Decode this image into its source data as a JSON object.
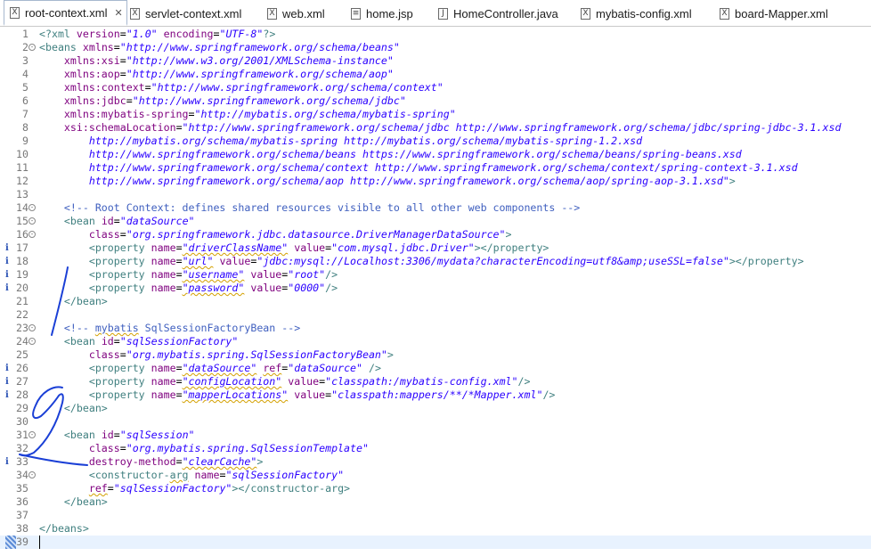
{
  "tabs": [
    {
      "label": "root-context.xml",
      "icon": "xml-file-icon",
      "active": true,
      "closable": true
    },
    {
      "label": "servlet-context.xml",
      "icon": "xml-file-icon"
    },
    {
      "label": "web.xml",
      "icon": "xml-file-icon"
    },
    {
      "label": "home.jsp",
      "icon": "jsp-file-icon"
    },
    {
      "label": "HomeController.java",
      "icon": "java-file-icon"
    },
    {
      "label": "mybatis-config.xml",
      "icon": "xml-file-icon"
    },
    {
      "label": "board-Mapper.xml",
      "icon": "xml-file-icon"
    }
  ],
  "colors": {
    "tag": "#3f7f7f",
    "attr": "#7f007f",
    "value": "#2a00ff",
    "comment": "#3f5fbf",
    "ink": "#1a3fd6",
    "info": "#2850b4"
  },
  "lines": [
    {
      "n": "1",
      "segs": [
        [
          "pi",
          "<?xml "
        ],
        [
          "attr",
          "version"
        ],
        [
          "txt",
          "="
        ],
        [
          "val",
          "\"1.0\""
        ],
        [
          "txt",
          " "
        ],
        [
          "attr",
          "encoding"
        ],
        [
          "txt",
          "="
        ],
        [
          "val",
          "\"UTF-8\""
        ],
        [
          "pi",
          "?>"
        ]
      ]
    },
    {
      "n": "2",
      "fold": "-",
      "segs": [
        [
          "tag",
          "<beans "
        ],
        [
          "attr",
          "xmlns"
        ],
        [
          "txt",
          "="
        ],
        [
          "val",
          "\"http://www.springframework.org/schema/beans\""
        ]
      ]
    },
    {
      "n": "3",
      "segs": [
        [
          "txt",
          "    "
        ],
        [
          "attr",
          "xmlns:xsi"
        ],
        [
          "txt",
          "="
        ],
        [
          "val",
          "\"http://www.w3.org/2001/XMLSchema-instance\""
        ]
      ]
    },
    {
      "n": "4",
      "segs": [
        [
          "txt",
          "    "
        ],
        [
          "attr",
          "xmlns:aop"
        ],
        [
          "txt",
          "="
        ],
        [
          "val",
          "\"http://www.springframework.org/schema/aop\""
        ]
      ]
    },
    {
      "n": "5",
      "segs": [
        [
          "txt",
          "    "
        ],
        [
          "attr",
          "xmlns:context"
        ],
        [
          "txt",
          "="
        ],
        [
          "val",
          "\"http://www.springframework.org/schema/context\""
        ]
      ]
    },
    {
      "n": "6",
      "segs": [
        [
          "txt",
          "    "
        ],
        [
          "attr",
          "xmlns:jdbc"
        ],
        [
          "txt",
          "="
        ],
        [
          "val",
          "\"http://www.springframework.org/schema/jdbc\""
        ]
      ]
    },
    {
      "n": "7",
      "segs": [
        [
          "txt",
          "    "
        ],
        [
          "attr",
          "xmlns:mybatis-spring"
        ],
        [
          "txt",
          "="
        ],
        [
          "val",
          "\"http://mybatis.org/schema/mybatis-spring\""
        ]
      ]
    },
    {
      "n": "8",
      "segs": [
        [
          "txt",
          "    "
        ],
        [
          "attr",
          "xsi:schemaLocation"
        ],
        [
          "txt",
          "="
        ],
        [
          "val",
          "\"http://www.springframework.org/schema/jdbc http://www.springframework.org/schema/jdbc/spring-jdbc-3.1.xsd"
        ]
      ]
    },
    {
      "n": "9",
      "segs": [
        [
          "txt",
          "        "
        ],
        [
          "val",
          "http://mybatis.org/schema/mybatis-spring http://mybatis.org/schema/mybatis-spring-1.2.xsd"
        ]
      ]
    },
    {
      "n": "10",
      "segs": [
        [
          "txt",
          "        "
        ],
        [
          "val",
          "http://www.springframework.org/schema/beans https://www.springframework.org/schema/beans/spring-beans.xsd"
        ]
      ]
    },
    {
      "n": "11",
      "segs": [
        [
          "txt",
          "        "
        ],
        [
          "val",
          "http://www.springframework.org/schema/context http://www.springframework.org/schema/context/spring-context-3.1.xsd"
        ]
      ]
    },
    {
      "n": "12",
      "segs": [
        [
          "txt",
          "        "
        ],
        [
          "val",
          "http://www.springframework.org/schema/aop http://www.springframework.org/schema/aop/spring-aop-3.1.xsd\""
        ],
        [
          "tag",
          ">"
        ]
      ]
    },
    {
      "n": "13",
      "segs": []
    },
    {
      "n": "14",
      "fold": "-",
      "segs": [
        [
          "txt",
          "    "
        ],
        [
          "com",
          "<!-- Root Context: defines shared resources visible to all other web components -->"
        ]
      ]
    },
    {
      "n": "15",
      "fold": "-",
      "segs": [
        [
          "txt",
          "    "
        ],
        [
          "tag",
          "<bean "
        ],
        [
          "attr",
          "id"
        ],
        [
          "txt",
          "="
        ],
        [
          "val",
          "\"dataSource\""
        ]
      ]
    },
    {
      "n": "16",
      "fold": "-",
      "segs": [
        [
          "txt",
          "        "
        ],
        [
          "attr",
          "class"
        ],
        [
          "txt",
          "="
        ],
        [
          "val",
          "\"org.springframework.jdbc.datasource.DriverManagerDataSource\""
        ],
        [
          "tag",
          ">"
        ]
      ]
    },
    {
      "n": "17",
      "info": "i",
      "segs": [
        [
          "txt",
          "        "
        ],
        [
          "tag",
          "<property "
        ],
        [
          "attr",
          "name"
        ],
        [
          "txt",
          "="
        ],
        [
          "val",
          "\"driverClassName\"",
          "sq"
        ],
        [
          "txt",
          " "
        ],
        [
          "attr",
          "value"
        ],
        [
          "txt",
          "="
        ],
        [
          "val",
          "\"com.mysql.jdbc.Driver\""
        ],
        [
          "tag",
          "></property>"
        ]
      ]
    },
    {
      "n": "18",
      "info": "i",
      "segs": [
        [
          "txt",
          "        "
        ],
        [
          "tag",
          "<property "
        ],
        [
          "attr",
          "name"
        ],
        [
          "txt",
          "="
        ],
        [
          "val",
          "\"url\"",
          "sq"
        ],
        [
          "txt",
          " "
        ],
        [
          "attr",
          "value"
        ],
        [
          "txt",
          "="
        ],
        [
          "val",
          "\"jdbc:mysql://Localhost:3306/mydata?characterEncoding=utf8&amp;useSSL=false\""
        ],
        [
          "tag",
          "></property>"
        ]
      ]
    },
    {
      "n": "19",
      "info": "i",
      "segs": [
        [
          "txt",
          "        "
        ],
        [
          "tag",
          "<property "
        ],
        [
          "attr",
          "name"
        ],
        [
          "txt",
          "="
        ],
        [
          "val",
          "\"username\"",
          "sq"
        ],
        [
          "txt",
          " "
        ],
        [
          "attr",
          "value"
        ],
        [
          "txt",
          "="
        ],
        [
          "val",
          "\"root\""
        ],
        [
          "tag",
          "/>"
        ]
      ]
    },
    {
      "n": "20",
      "info": "i",
      "segs": [
        [
          "txt",
          "        "
        ],
        [
          "tag",
          "<property "
        ],
        [
          "attr",
          "name"
        ],
        [
          "txt",
          "="
        ],
        [
          "val",
          "\"password\"",
          "sq"
        ],
        [
          "txt",
          " "
        ],
        [
          "attr",
          "value"
        ],
        [
          "txt",
          "="
        ],
        [
          "val",
          "\"0000\""
        ],
        [
          "tag",
          "/>"
        ]
      ]
    },
    {
      "n": "21",
      "segs": [
        [
          "txt",
          "    "
        ],
        [
          "tag",
          "</bean>"
        ]
      ]
    },
    {
      "n": "22",
      "segs": []
    },
    {
      "n": "23",
      "fold": "-",
      "segs": [
        [
          "txt",
          "    "
        ],
        [
          "com",
          "<!-- "
        ],
        [
          "com",
          "mybatis",
          "sq"
        ],
        [
          "com",
          " SqlSessionFactoryBean -->"
        ]
      ]
    },
    {
      "n": "24",
      "fold": "-",
      "segs": [
        [
          "txt",
          "    "
        ],
        [
          "tag",
          "<bean "
        ],
        [
          "attr",
          "id"
        ],
        [
          "txt",
          "="
        ],
        [
          "val",
          "\"sqlSessionFactory\""
        ]
      ]
    },
    {
      "n": "25",
      "segs": [
        [
          "txt",
          "        "
        ],
        [
          "attr",
          "class"
        ],
        [
          "txt",
          "="
        ],
        [
          "val",
          "\"org.mybatis.spring.SqlSessionFactoryBean\""
        ],
        [
          "tag",
          ">"
        ]
      ]
    },
    {
      "n": "26",
      "info": "i",
      "segs": [
        [
          "txt",
          "        "
        ],
        [
          "tag",
          "<property "
        ],
        [
          "attr",
          "name"
        ],
        [
          "txt",
          "="
        ],
        [
          "val",
          "\"dataSource\"",
          "sq"
        ],
        [
          "txt",
          " "
        ],
        [
          "attr",
          "ref",
          "sq"
        ],
        [
          "txt",
          "="
        ],
        [
          "val",
          "\"dataSource\""
        ],
        [
          "txt",
          " "
        ],
        [
          "tag",
          "/>"
        ]
      ]
    },
    {
      "n": "27",
      "info": "i",
      "segs": [
        [
          "txt",
          "        "
        ],
        [
          "tag",
          "<property "
        ],
        [
          "attr",
          "name"
        ],
        [
          "txt",
          "="
        ],
        [
          "val",
          "\"configLocation\"",
          "sq"
        ],
        [
          "txt",
          " "
        ],
        [
          "attr",
          "value"
        ],
        [
          "txt",
          "="
        ],
        [
          "val",
          "\"classpath:/mybatis-config.xml\""
        ],
        [
          "tag",
          "/>"
        ]
      ]
    },
    {
      "n": "28",
      "info": "i",
      "segs": [
        [
          "txt",
          "        "
        ],
        [
          "tag",
          "<property "
        ],
        [
          "attr",
          "name"
        ],
        [
          "txt",
          "="
        ],
        [
          "val",
          "\"mapperLocations\"",
          "sq"
        ],
        [
          "txt",
          " "
        ],
        [
          "attr",
          "value"
        ],
        [
          "txt",
          "="
        ],
        [
          "val",
          "\"classpath:mappers/**/*Mapper.xml\""
        ],
        [
          "tag",
          "/>"
        ]
      ]
    },
    {
      "n": "29",
      "segs": [
        [
          "txt",
          "    "
        ],
        [
          "tag",
          "</bean>"
        ]
      ]
    },
    {
      "n": "30",
      "segs": []
    },
    {
      "n": "31",
      "fold": "-",
      "segs": [
        [
          "txt",
          "    "
        ],
        [
          "tag",
          "<bean "
        ],
        [
          "attr",
          "id"
        ],
        [
          "txt",
          "="
        ],
        [
          "val",
          "\"sqlSession\""
        ]
      ]
    },
    {
      "n": "32",
      "segs": [
        [
          "txt",
          "        "
        ],
        [
          "attr",
          "class"
        ],
        [
          "txt",
          "="
        ],
        [
          "val",
          "\"org.mybatis.spring.SqlSessionTemplate\""
        ]
      ]
    },
    {
      "n": "33",
      "info": "i",
      "segs": [
        [
          "txt",
          "        "
        ],
        [
          "attr",
          "destroy-method"
        ],
        [
          "txt",
          "="
        ],
        [
          "val",
          "\"clearCache\"",
          "sq"
        ],
        [
          "tag",
          ">"
        ]
      ]
    },
    {
      "n": "34",
      "fold": "-",
      "segs": [
        [
          "txt",
          "        "
        ],
        [
          "tag",
          "<constructor-"
        ],
        [
          "tag",
          "arg",
          "sq"
        ],
        [
          "txt",
          " "
        ],
        [
          "attr",
          "name"
        ],
        [
          "txt",
          "="
        ],
        [
          "val",
          "\"sqlSessionFactory\""
        ]
      ]
    },
    {
      "n": "35",
      "segs": [
        [
          "txt",
          "        "
        ],
        [
          "attr",
          "ref",
          "sq"
        ],
        [
          "txt",
          "="
        ],
        [
          "val",
          "\"sqlSessionFactory\""
        ],
        [
          "tag",
          "></constructor-arg>"
        ]
      ]
    },
    {
      "n": "36",
      "segs": [
        [
          "txt",
          "    "
        ],
        [
          "tag",
          "</bean>"
        ]
      ]
    },
    {
      "n": "37",
      "segs": []
    },
    {
      "n": "38",
      "segs": [
        [
          "tag",
          "</beans>"
        ]
      ]
    },
    {
      "n": "39",
      "current": true,
      "segs": []
    }
  ]
}
